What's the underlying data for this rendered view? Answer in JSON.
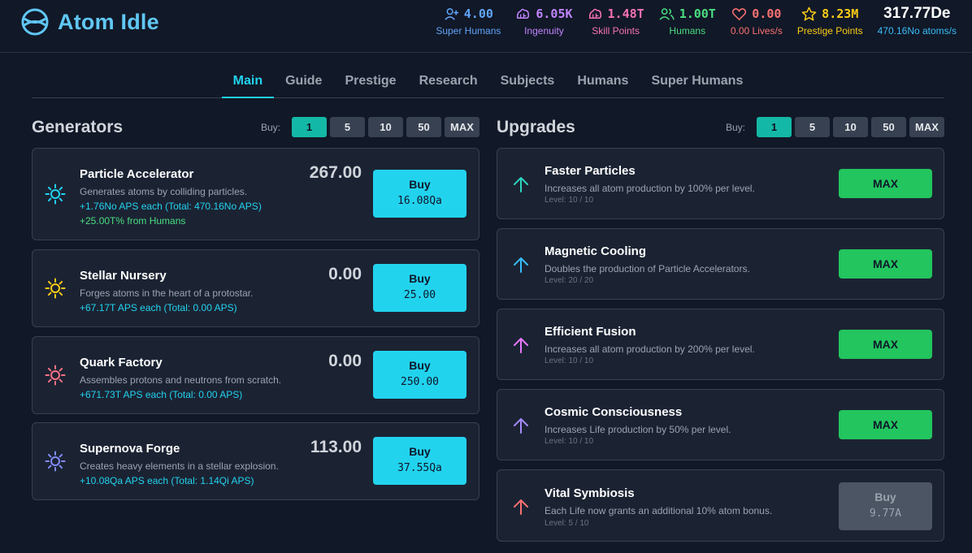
{
  "app": {
    "title": "Atom Idle"
  },
  "stats": {
    "super_humans": {
      "value": "4.00",
      "label": "Super Humans",
      "icon": "user-plus-icon",
      "color": "#60a5fa"
    },
    "ingenuity": {
      "value": "6.05K",
      "label": "Ingenuity",
      "icon": "brain-icon",
      "color": "#c084fc"
    },
    "skill_points": {
      "value": "1.48T",
      "label": "Skill Points",
      "icon": "brain-icon",
      "color": "#f472b6"
    },
    "humans": {
      "value": "1.00T",
      "label": "Humans",
      "icon": "users-icon",
      "color": "#4ade80"
    },
    "lives": {
      "value": "0.00",
      "label": "0.00 Lives/s",
      "icon": "heart-icon",
      "color": "#f87171"
    },
    "prestige_points": {
      "value": "8.23M",
      "label": "Prestige Points",
      "icon": "star-icon",
      "color": "#facc15"
    },
    "atoms": {
      "value": "317.77De",
      "label": "470.16No atoms/s",
      "color": "#38bdf8"
    }
  },
  "tabs": [
    {
      "label": "Main",
      "active": true
    },
    {
      "label": "Guide"
    },
    {
      "label": "Prestige"
    },
    {
      "label": "Research"
    },
    {
      "label": "Subjects"
    },
    {
      "label": "Humans"
    },
    {
      "label": "Super Humans"
    }
  ],
  "generators": {
    "title": "Generators",
    "buy_label": "Buy:",
    "quantities": [
      "1",
      "5",
      "10",
      "50",
      "MAX"
    ],
    "selected_quantity": "1",
    "items": [
      {
        "name": "Particle Accelerator",
        "description": "Generates atoms by colliding particles.",
        "aps": "+1.76No APS each (Total: 470.16No APS)",
        "bonus": "+25.00T% from Humans",
        "count": "267.00",
        "buy_label": "Buy",
        "cost": "16.08Qa",
        "icon": "sun-icon",
        "icon_color": "#22d3ee"
      },
      {
        "name": "Stellar Nursery",
        "description": "Forges atoms in the heart of a protostar.",
        "aps": "+67.17T APS each (Total: 0.00 APS)",
        "count": "0.00",
        "buy_label": "Buy",
        "cost": "25.00",
        "icon": "sun-icon",
        "icon_color": "#facc15"
      },
      {
        "name": "Quark Factory",
        "description": "Assembles protons and neutrons from scratch.",
        "aps": "+671.73T APS each (Total: 0.00 APS)",
        "count": "0.00",
        "buy_label": "Buy",
        "cost": "250.00",
        "icon": "sun-icon",
        "icon_color": "#fb7185"
      },
      {
        "name": "Supernova Forge",
        "description": "Creates heavy elements in a stellar explosion.",
        "aps": "+10.08Qa APS each (Total: 1.14Qi APS)",
        "count": "113.00",
        "buy_label": "Buy",
        "cost": "37.55Qa",
        "icon": "sun-icon",
        "icon_color": "#818cf8"
      }
    ]
  },
  "upgrades": {
    "title": "Upgrades",
    "buy_label": "Buy:",
    "quantities": [
      "1",
      "5",
      "10",
      "50",
      "MAX"
    ],
    "selected_quantity": "1",
    "items": [
      {
        "name": "Faster Particles",
        "description": "Increases all atom production by 100% per level.",
        "level": "Level: 10 / 10",
        "button": "MAX",
        "icon": "arrow-up-icon",
        "icon_color": "#2dd4bf"
      },
      {
        "name": "Magnetic Cooling",
        "description": "Doubles the production of Particle Accelerators.",
        "level": "Level: 20 / 20",
        "button": "MAX",
        "icon": "arrow-up-icon",
        "icon_color": "#38bdf8"
      },
      {
        "name": "Efficient Fusion",
        "description": "Increases all atom production by 200% per level.",
        "level": "Level: 10 / 10",
        "button": "MAX",
        "icon": "arrow-up-icon",
        "icon_color": "#e879f9"
      },
      {
        "name": "Cosmic Consciousness",
        "description": "Increases Life production by 50% per level.",
        "level": "Level: 10 / 10",
        "button": "MAX",
        "icon": "arrow-up-icon",
        "icon_color": "#a78bfa"
      },
      {
        "name": "Vital Symbiosis",
        "description": "Each Life now grants an additional 10% atom bonus.",
        "level": "Level: 5 / 10",
        "button": "Buy",
        "cost": "9.77A",
        "icon": "arrow-up-icon",
        "icon_color": "#f87171"
      }
    ]
  }
}
